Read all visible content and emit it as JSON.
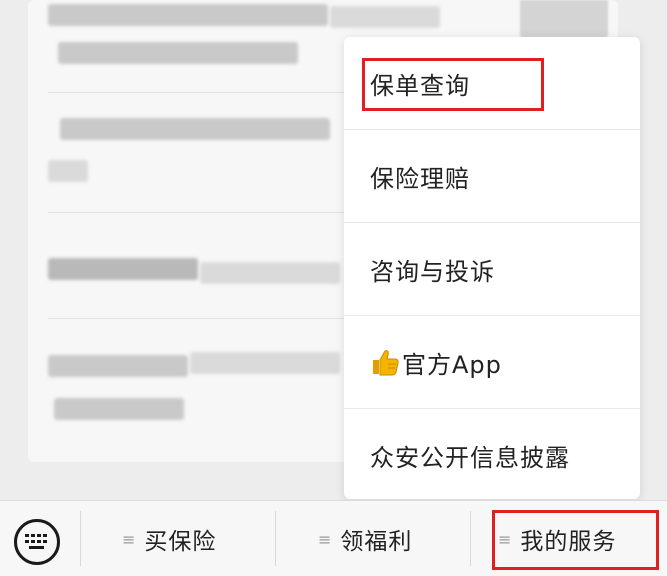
{
  "popup_menu": {
    "items": [
      {
        "label": "保单查询"
      },
      {
        "label": "保险理赔"
      },
      {
        "label": "咨询与投诉"
      },
      {
        "label": "官方App",
        "icon": "thumbs-up-icon"
      },
      {
        "label": "众安公开信息披露"
      }
    ]
  },
  "bottom_bar": {
    "keyboard_icon": "keyboard-icon",
    "menu_glyph": "≡",
    "tabs": [
      {
        "label": "买保险"
      },
      {
        "label": "领福利"
      },
      {
        "label": "我的服务"
      }
    ]
  },
  "highlight_color": "#e02020",
  "thumb_color": "#f5b400"
}
